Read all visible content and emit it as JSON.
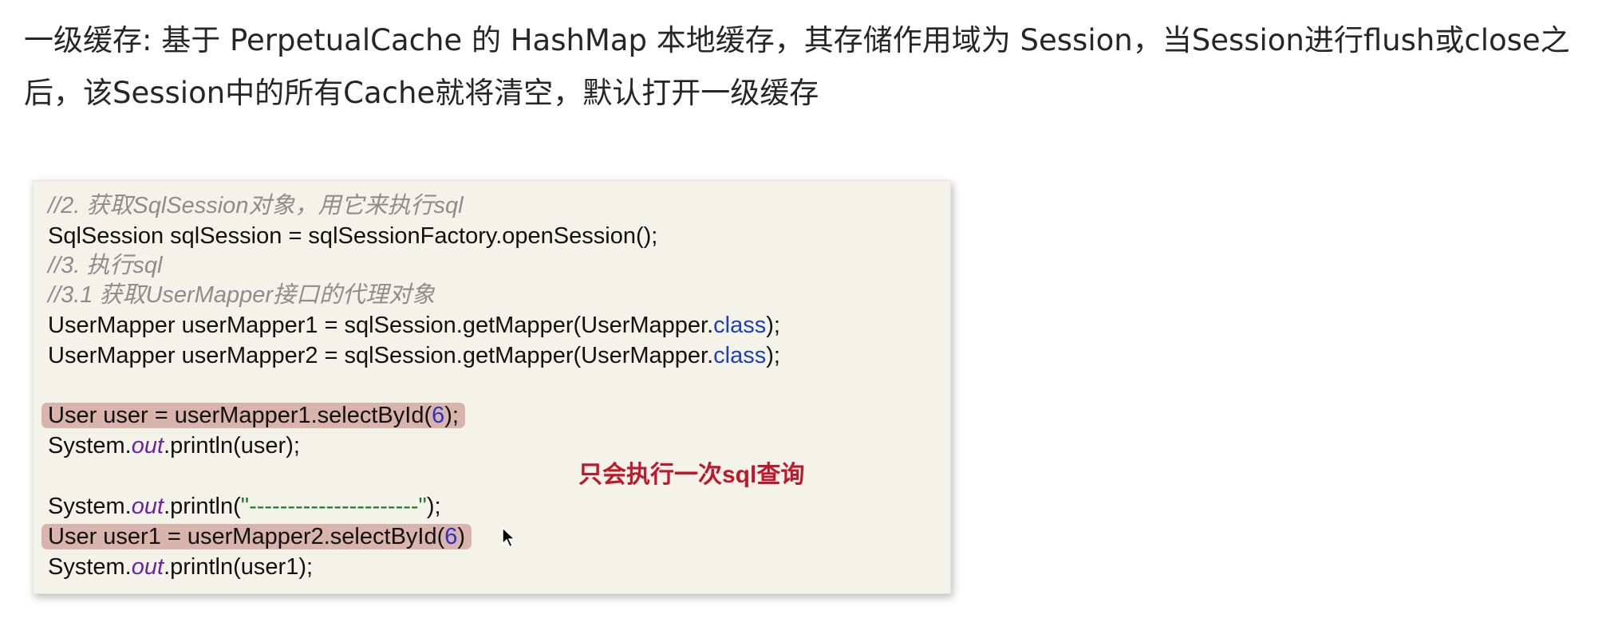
{
  "intro_text": "一级缓存: 基于 PerpetualCache 的 HashMap 本地缓存，其存储作用域为 Session，当Session进行flush或close之后，该Session中的所有Cache就将清空，默认打开一级缓存",
  "code": {
    "l1": "//2. 获取SqlSession对象，用它来执行sql",
    "l2": "SqlSession sqlSession = sqlSessionFactory.openSession();",
    "l3": "//3. 执行sql",
    "l4": "//3.1 获取UserMapper接口的代理对象",
    "l5_pre": "UserMapper userMapper1 = sqlSession.getMapper(UserMapper.",
    "l5_kw": "class",
    "l5_post": ");",
    "l6_pre": "UserMapper userMapper2 = sqlSession.getMapper(UserMapper.",
    "l6_kw": "class",
    "l6_post": ");",
    "l7_pre": "User user = userMapper1.selectById(",
    "l7_num": "6",
    "l7_post": ");",
    "l8_pre": "System.",
    "l8_field": "out",
    "l8_post": ".println(user);",
    "l9_pre": "System.",
    "l9_field": "out",
    "l9_mid": ".println(",
    "l9_str": "\"----------------------\"",
    "l9_post": ");",
    "l10_pre": "User user1 = userMapper2.selectById(",
    "l10_num": "6",
    "l10_post": ")",
    "l11_pre": "System.",
    "l11_field": "out",
    "l11_post": ".println(user1);"
  },
  "note": "只会执行一次sql查询",
  "colors": {
    "comment": "#8d8d8d",
    "keyword": "#1f3fb8",
    "field": "#6a22a8",
    "string": "#1c7b2a",
    "note": "#c0182a",
    "highlight": "#d8b4ac",
    "card_bg": "#f3f3ea"
  }
}
